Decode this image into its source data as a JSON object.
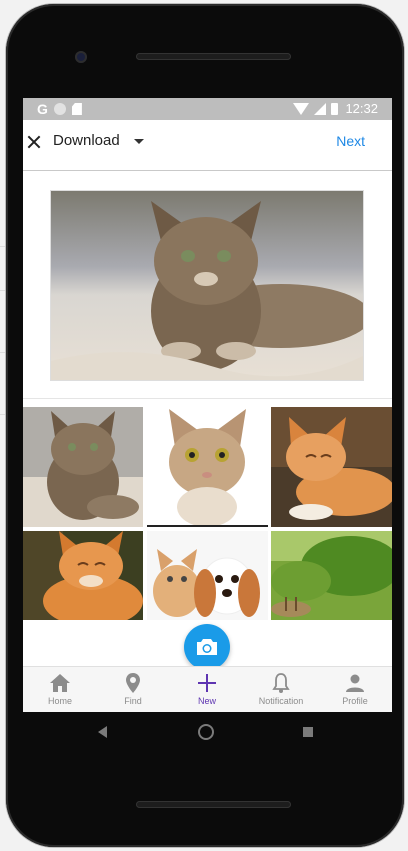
{
  "status_bar": {
    "left_icons": [
      "google-icon",
      "sync-icon",
      "sd-card-icon"
    ],
    "google_letter": "G",
    "right_icons": [
      "wifi-icon",
      "signal-icon",
      "battery-icon"
    ],
    "time": "12:32"
  },
  "top_bar": {
    "close_icon": "close-icon",
    "album_label": "Download",
    "dropdown_icon": "caret-down-icon",
    "next_label": "Next",
    "accent_color": "#1e88e5"
  },
  "preview": {
    "image": "tabby cat lying on a blanket"
  },
  "grid": [
    {
      "image": "tabby cat lying on a blanket"
    },
    {
      "image": "tabby kitten face on white background"
    },
    {
      "image": "orange cat sleeping on wooden deck"
    },
    {
      "image": "orange cat with closed eyes outdoors"
    },
    {
      "image": "kitten and spaniel puppy"
    },
    {
      "image": "green foliage with deer"
    }
  ],
  "camera_button": {
    "icon": "camera-icon",
    "color": "#1a9be8"
  },
  "bottom_nav": [
    {
      "label": "Home",
      "icon": "home-icon"
    },
    {
      "label": "Find",
      "icon": "map-pin-icon"
    },
    {
      "label": "New",
      "icon": "plus-icon",
      "active": true
    },
    {
      "label": "Notification",
      "icon": "bell-icon"
    },
    {
      "label": "Profile",
      "icon": "person-icon"
    }
  ],
  "active_color": "#5e35b1",
  "system_nav": [
    "back-icon",
    "home-button-icon",
    "recents-icon"
  ]
}
